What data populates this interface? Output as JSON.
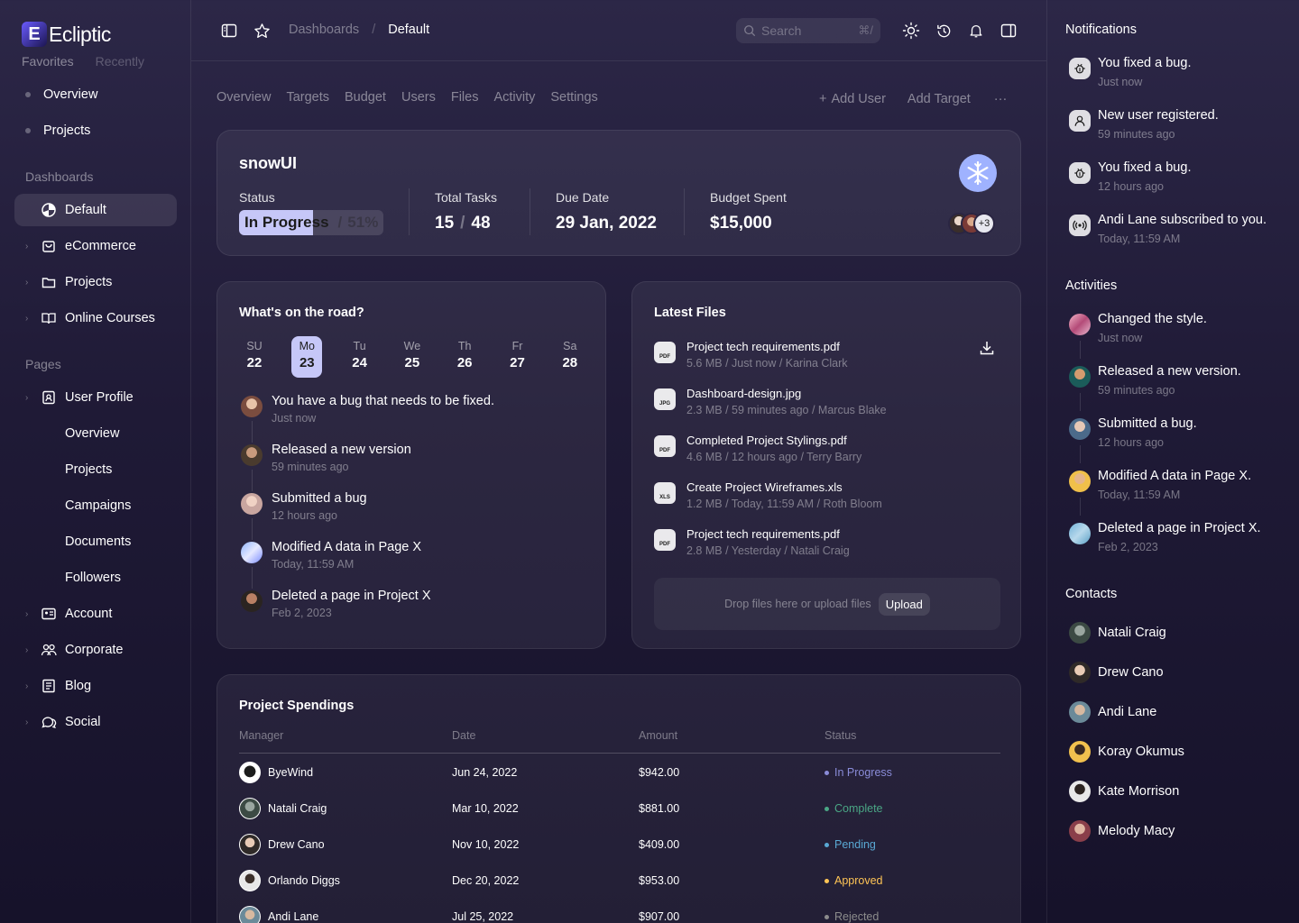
{
  "brand": {
    "name": "Ecliptic",
    "mark": "E"
  },
  "sidebar": {
    "tabs": [
      "Favorites",
      "Recently"
    ],
    "favorites": [
      "Overview",
      "Projects"
    ],
    "dashboards_title": "Dashboards",
    "dashboards": [
      "Default",
      "eCommerce",
      "Projects",
      "Online Courses"
    ],
    "pages_title": "Pages",
    "pages": {
      "user_profile": "User Profile",
      "user_profile_sub": [
        "Overview",
        "Projects",
        "Campaigns",
        "Documents",
        "Followers"
      ],
      "others": [
        "Account",
        "Corporate",
        "Blog",
        "Social"
      ]
    }
  },
  "topbar": {
    "breadcrumb": [
      "Dashboards",
      "/",
      "Default"
    ],
    "search_placeholder": "Search",
    "search_shortcut": "⌘/"
  },
  "tabs": [
    "Overview",
    "Targets",
    "Budget",
    "Users",
    "Files",
    "Activity",
    "Settings"
  ],
  "tab_actions": {
    "add_user": "Add User",
    "add_target": "Add Target",
    "more": "···"
  },
  "project": {
    "name": "snowUI",
    "status_label": "Status",
    "status_value": "In Progress",
    "status_percent_text": "51%",
    "status_percent": 0.51,
    "total_tasks_label": "Total Tasks",
    "tasks_done": "15",
    "tasks_sep": "/",
    "tasks_total": "48",
    "due_label": "Due Date",
    "due_value": "29 Jan, 2022",
    "budget_label": "Budget Spent",
    "budget_value": "$15,000",
    "extra_members": "+3"
  },
  "road": {
    "title": "What's on the road?",
    "days": [
      {
        "name": "SU",
        "date": "22"
      },
      {
        "name": "Mo",
        "date": "23"
      },
      {
        "name": "Tu",
        "date": "24"
      },
      {
        "name": "We",
        "date": "25"
      },
      {
        "name": "Th",
        "date": "26"
      },
      {
        "name": "Fr",
        "date": "27"
      },
      {
        "name": "Sa",
        "date": "28"
      }
    ],
    "events": [
      {
        "text": "You have a bug that needs to be fixed.",
        "time": "Just now"
      },
      {
        "text": "Released a new version",
        "time": "59 minutes ago"
      },
      {
        "text": "Submitted a bug",
        "time": "12 hours ago"
      },
      {
        "text": "Modified A data in Page X",
        "time": "Today, 11:59 AM"
      },
      {
        "text": "Deleted a page in Project X",
        "time": "Feb 2, 2023"
      }
    ]
  },
  "files": {
    "title": "Latest Files",
    "items": [
      {
        "type": "PDF",
        "name": "Project tech requirements.pdf",
        "meta": "5.6 MB / Just now / Karina Clark"
      },
      {
        "type": "JPG",
        "name": "Dashboard-design.jpg",
        "meta": "2.3 MB / 59 minutes ago / Marcus Blake"
      },
      {
        "type": "PDF",
        "name": "Completed Project Stylings.pdf",
        "meta": "4.6 MB / 12 hours ago / Terry Barry"
      },
      {
        "type": "XLS",
        "name": "Create Project Wireframes.xls",
        "meta": "1.2 MB / Today, 11:59 AM / Roth Bloom"
      },
      {
        "type": "PDF",
        "name": "Project tech requirements.pdf",
        "meta": "2.8 MB / Yesterday / Natali Craig"
      }
    ],
    "drop_text": "Drop files here or upload files",
    "upload_label": "Upload"
  },
  "spendings": {
    "title": "Project Spendings",
    "columns": [
      "Manager",
      "Date",
      "Amount",
      "Status"
    ],
    "rows": [
      {
        "manager": "ByeWind",
        "date": "Jun 24, 2022",
        "amount": "$942.00",
        "status": "In Progress",
        "color": "#8a8cd9"
      },
      {
        "manager": "Natali Craig",
        "date": "Mar 10, 2022",
        "amount": "$881.00",
        "status": "Complete",
        "color": "#4aa785"
      },
      {
        "manager": "Drew Cano",
        "date": "Nov 10, 2022",
        "amount": "$409.00",
        "status": "Pending",
        "color": "#59a8d4"
      },
      {
        "manager": "Orlando Diggs",
        "date": "Dec 20, 2022",
        "amount": "$953.00",
        "status": "Approved",
        "color": "#ffc555"
      },
      {
        "manager": "Andi Lane",
        "date": "Jul 25, 2022",
        "amount": "$907.00",
        "status": "Rejected",
        "color": "#8c8c8c"
      }
    ]
  },
  "notifications": {
    "title": "Notifications",
    "items": [
      {
        "icon": "bug-icon",
        "text": "You fixed a bug.",
        "time": "Just now"
      },
      {
        "icon": "user-icon",
        "text": "New user registered.",
        "time": "59 minutes ago"
      },
      {
        "icon": "bug-icon",
        "text": "You fixed a bug.",
        "time": "12 hours ago"
      },
      {
        "icon": "broadcast-icon",
        "text": "Andi Lane subscribed to you.",
        "time": "Today, 11:59 AM"
      }
    ]
  },
  "activities": {
    "title": "Activities",
    "items": [
      {
        "text": "Changed the style.",
        "time": "Just now"
      },
      {
        "text": "Released a new version.",
        "time": "59 minutes ago"
      },
      {
        "text": "Submitted a bug.",
        "time": "12 hours ago"
      },
      {
        "text": "Modified A data in Page X.",
        "time": "Today, 11:59 AM"
      },
      {
        "text": "Deleted a page in Project X.",
        "time": "Feb 2, 2023"
      }
    ]
  },
  "contacts": {
    "title": "Contacts",
    "items": [
      "Natali Craig",
      "Drew Cano",
      "Andi Lane",
      "Koray Okumus",
      "Kate Morrison",
      "Melody Macy"
    ]
  },
  "colors": {
    "accent": "#c6c7f8",
    "bg_top": "#2c2747",
    "bg_bottom": "#16122a"
  }
}
